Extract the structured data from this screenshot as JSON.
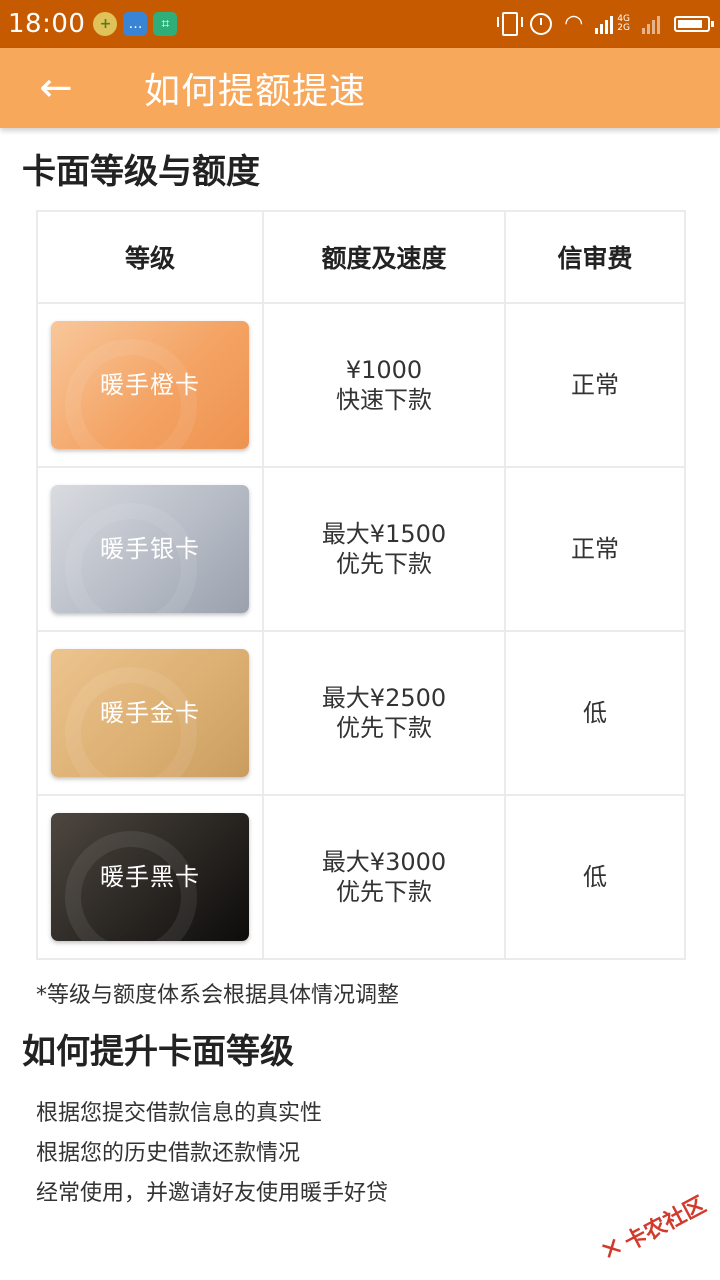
{
  "status_bar": {
    "time": "18:00",
    "network_top": "4G",
    "network_bottom": "2G",
    "battery_level": 0.85
  },
  "app_bar": {
    "back_icon": "arrow-left",
    "title": "如何提额提速"
  },
  "section_levels": {
    "title": "卡面等级与额度",
    "headers": [
      "等级",
      "额度及速度",
      "信审费"
    ],
    "rows": [
      {
        "card": "暖手橙卡",
        "limit": "¥1000",
        "speed": "快速下款",
        "fee": "正常"
      },
      {
        "card": "暖手银卡",
        "limit": "最大¥1500",
        "speed": "优先下款",
        "fee": "正常"
      },
      {
        "card": "暖手金卡",
        "limit": "最大¥2500",
        "speed": "优先下款",
        "fee": "低"
      },
      {
        "card": "暖手黑卡",
        "limit": "最大¥3000",
        "speed": "优先下款",
        "fee": "低"
      }
    ],
    "note": "*等级与额度体系会根据具体情况调整"
  },
  "section_upgrade": {
    "title": "如何提升卡面等级",
    "tips": [
      "根据您提交借款信息的真实性",
      "根据您的历史借款还款情况",
      "经常使用，并邀请好友使用暖手好贷"
    ]
  },
  "watermark": "卡农社区",
  "colors": {
    "status_bar": "#c55a00",
    "app_bar": "#f8a85a",
    "watermark": "#d23a2c"
  }
}
